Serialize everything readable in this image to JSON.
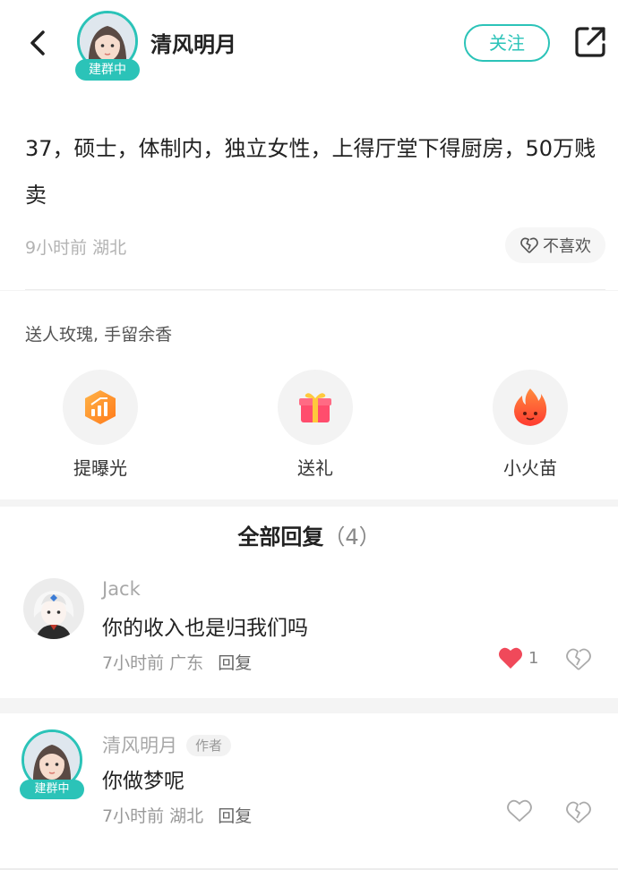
{
  "header": {
    "name": "清风明月",
    "badge": "建群中",
    "follow_label": "关注"
  },
  "post": {
    "text": "37，硕士，体制内，独立女性，上得厅堂下得厨房，50万贱卖",
    "time": "9小时前",
    "location": "湖北",
    "dislike_label": "不喜欢"
  },
  "gifts": {
    "title": "送人玫瑰, 手留余香",
    "items": [
      {
        "label": "提曝光",
        "icon": "boost-icon"
      },
      {
        "label": "送礼",
        "icon": "gift-box-icon"
      },
      {
        "label": "小火苗",
        "icon": "flame-icon"
      }
    ]
  },
  "replies": {
    "title": "全部回复",
    "count": "（4）",
    "items": [
      {
        "name": "Jack",
        "text": "你的收入也是归我们吗",
        "time": "7小时前",
        "location": "广东",
        "reply_label": "回复",
        "likes": "1",
        "liked": true
      },
      {
        "name": "清风明月",
        "author_tag": "作者",
        "badge": "建群中",
        "text": "你做梦呢",
        "time": "7小时前",
        "location": "湖北",
        "reply_label": "回复",
        "liked": false
      }
    ]
  },
  "colors": {
    "accent": "#2bc3b8",
    "like_red": "#f0495a"
  }
}
